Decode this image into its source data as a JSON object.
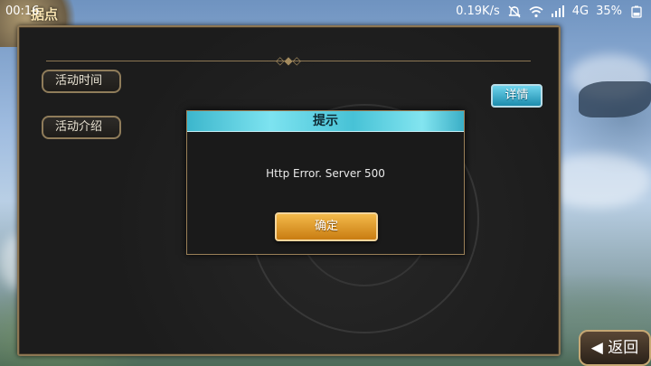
{
  "status_bar": {
    "time": "00:16",
    "network_speed": "0.19K/s",
    "signal_type": "4G",
    "battery": "35%",
    "icons": [
      "mute-icon",
      "wifi-icon",
      "signal-icon",
      "battery-icon"
    ]
  },
  "header": {
    "title_fragment": "据点"
  },
  "tabs": [
    {
      "label": "活动时间"
    },
    {
      "label": "活动介绍"
    }
  ],
  "detail_button": {
    "label": "详情"
  },
  "dialog": {
    "title": "提示",
    "message": "Http Error. Server 500",
    "confirm_label": "确定"
  },
  "back_button": {
    "label": "返回",
    "icon": "back-arrow-icon"
  },
  "colors": {
    "panel_border": "#8d7754",
    "dialog_header": "#47c2d6",
    "confirm_button": "#e39a2b",
    "detail_button": "#2ea7c8"
  }
}
